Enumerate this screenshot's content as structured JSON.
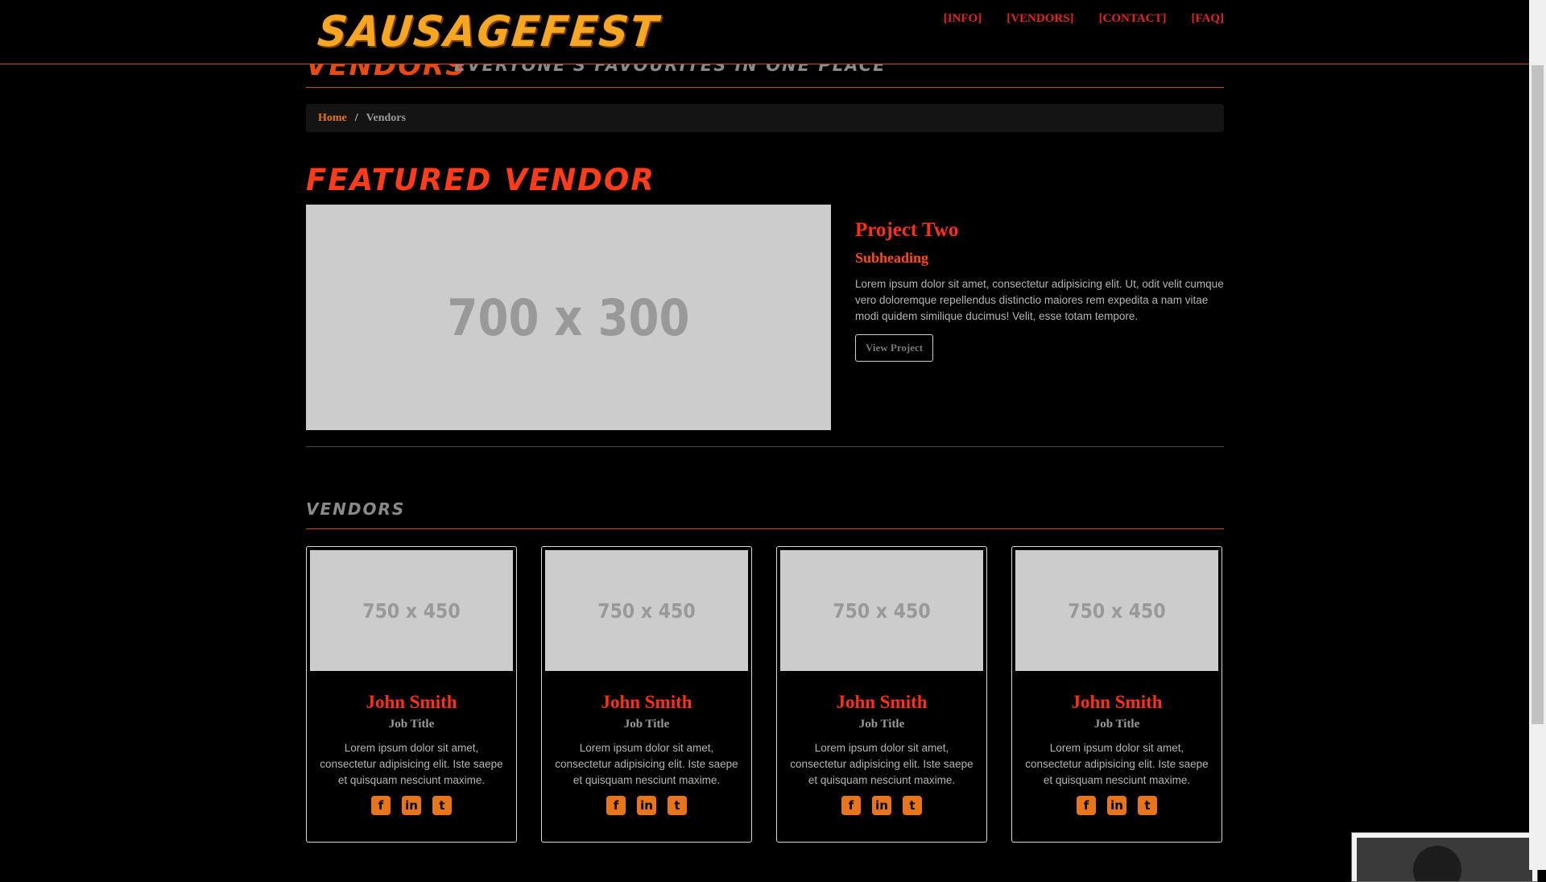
{
  "brand": "SAUSAGEFEST",
  "nav": [
    {
      "label": "[INFO]"
    },
    {
      "label": "[VENDORS]"
    },
    {
      "label": "[CONTACT]"
    },
    {
      "label": "[FAQ]"
    }
  ],
  "page_header": {
    "title": "Vendors",
    "subtitle": "Everyone's favourites in one place"
  },
  "breadcrumb": {
    "home": "Home",
    "separator": "/",
    "current": "Vendors"
  },
  "featured": {
    "section_title": "Featured Vendor",
    "image_placeholder": "700 x 300",
    "title": "Project Two",
    "subheading": "Subheading",
    "text": "Lorem ipsum dolor sit amet, consectetur adipisicing elit. Ut, odit velit cumque vero doloremque repellendus distinctio maiores rem expedita a nam vitae modi quidem similique ducimus! Velit, esse totam tempore.",
    "button": "View Project"
  },
  "vendors_heading": "Vendors",
  "vendors": [
    {
      "image_placeholder": "750 x 450",
      "name": "John Smith",
      "job": "Job Title",
      "text": "Lorem ipsum dolor sit amet, consectetur adipisicing elit. Iste saepe et quisquam nesciunt maxime."
    },
    {
      "image_placeholder": "750 x 450",
      "name": "John Smith",
      "job": "Job Title",
      "text": "Lorem ipsum dolor sit amet, consectetur adipisicing elit. Iste saepe et quisquam nesciunt maxime."
    },
    {
      "image_placeholder": "750 x 450",
      "name": "John Smith",
      "job": "Job Title",
      "text": "Lorem ipsum dolor sit amet, consectetur adipisicing elit. Iste saepe et quisquam nesciunt maxime."
    },
    {
      "image_placeholder": "750 x 450",
      "name": "John Smith",
      "job": "Job Title",
      "text": "Lorem ipsum dolor sit amet, consectetur adipisicing elit. Iste saepe et quisquam nesciunt maxime."
    }
  ],
  "social_icons": [
    "facebook-icon",
    "linkedin-icon",
    "twitter-icon"
  ],
  "colors": {
    "brand": "#f5a623",
    "accent_red": "#ff2e16",
    "accent_orange": "#e8751a",
    "background": "#000000"
  }
}
